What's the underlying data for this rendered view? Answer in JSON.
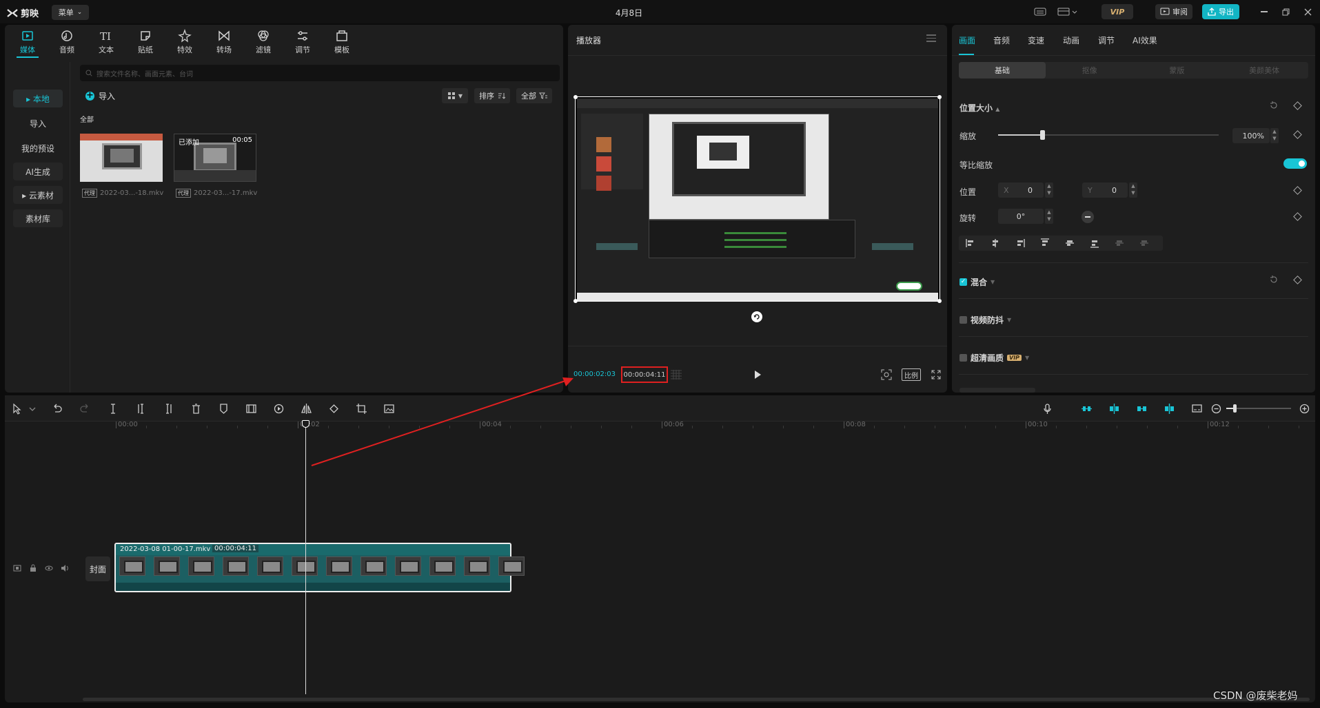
{
  "titlebar": {
    "app_name": "剪映",
    "menu_label": "菜单",
    "title": "4月8日",
    "vip_label": "VIP",
    "review_label": "审阅",
    "export_label": "导出"
  },
  "toolbar_tabs": [
    {
      "label": "媒体",
      "icon": "media-icon",
      "active": true
    },
    {
      "label": "音频",
      "icon": "audio-icon"
    },
    {
      "label": "文本",
      "icon": "text-icon"
    },
    {
      "label": "贴纸",
      "icon": "sticker-icon"
    },
    {
      "label": "特效",
      "icon": "effects-icon"
    },
    {
      "label": "转场",
      "icon": "transition-icon"
    },
    {
      "label": "滤镜",
      "icon": "filter-icon"
    },
    {
      "label": "调节",
      "icon": "adjust-icon"
    },
    {
      "label": "模板",
      "icon": "template-icon"
    }
  ],
  "sidebar": {
    "items": [
      {
        "label": "▸ 本地",
        "active": true
      },
      {
        "label": "导入"
      },
      {
        "label": "我的预设"
      },
      {
        "label": "AI生成"
      },
      {
        "label": "▸ 云素材"
      },
      {
        "label": "素材库"
      }
    ]
  },
  "media": {
    "search_placeholder": "搜索文件名称、画面元素、台词",
    "import_label": "导入",
    "sort_label": "排序",
    "filter_label": "全部",
    "section_label": "全部",
    "items": [
      {
        "name": "2022-03...-18.mkv",
        "badge": "代理"
      },
      {
        "name": "2022-03...-17.mkv",
        "badge": "代理",
        "added_label": "已添加",
        "duration": "00:05"
      }
    ]
  },
  "player": {
    "title": "播放器",
    "current_time": "00:00:02:03",
    "total_time": "00:00:04:11",
    "ratio_label": "比例"
  },
  "right_panel": {
    "tabs": [
      "画面",
      "音频",
      "变速",
      "动画",
      "调节",
      "AI效果"
    ],
    "subtabs": [
      "基础",
      "抠像",
      "蒙版",
      "美颜美体"
    ],
    "section_position": "位置大小",
    "scale_label": "缩放",
    "scale_value": "100%",
    "scale_fraction": 0.2,
    "uniform_label": "等比缩放",
    "position_label": "位置",
    "x_label": "X",
    "x_value": "0",
    "y_label": "Y",
    "y_value": "0",
    "rotate_label": "旋转",
    "rotate_value": "0°",
    "blend_label": "混合",
    "stabilize_label": "视频防抖",
    "hd_label": "超清画质",
    "hd_badge": "VIP"
  },
  "timeline": {
    "ruler": [
      "00:00",
      "00:02",
      "00:04",
      "00:06",
      "00:08",
      "00:10",
      "00:12"
    ],
    "cover_label": "封面",
    "clip_name": "2022-03-08 01-00-17.mkv",
    "clip_duration": "00:00:04:11"
  },
  "watermark": "CSDN @废柴老妈"
}
